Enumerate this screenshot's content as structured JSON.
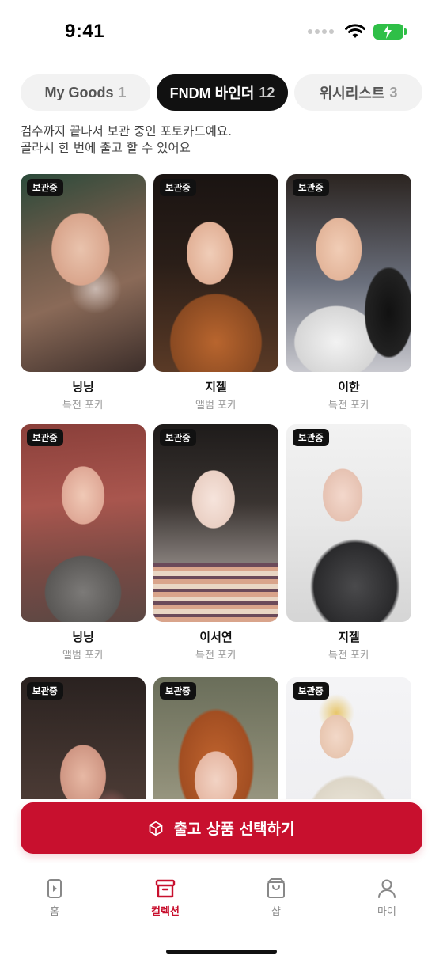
{
  "status_bar": {
    "time": "9:41",
    "icons": [
      "signal-dots-icon",
      "wifi-icon",
      "battery-charging-icon"
    ]
  },
  "tabs": [
    {
      "label": "My Goods",
      "count": "1",
      "active": false
    },
    {
      "label": "FNDM 바인더",
      "count": "12",
      "active": true
    },
    {
      "label": "위시리스트",
      "count": "3",
      "active": false
    }
  ],
  "description": {
    "line1": "검수까지 끝나서 보관 중인 포토카드예요.",
    "line2": "골라서 한 번에 출고 할 수 있어요"
  },
  "cards": [
    {
      "badge": "보관중",
      "name": "닝닝",
      "type": "특전 포카"
    },
    {
      "badge": "보관중",
      "name": "지젤",
      "type": "앨범 포카"
    },
    {
      "badge": "보관중",
      "name": "이한",
      "type": "특전 포카"
    },
    {
      "badge": "보관중",
      "name": "닝닝",
      "type": "앨범 포카"
    },
    {
      "badge": "보관중",
      "name": "이서연",
      "type": "특전 포카"
    },
    {
      "badge": "보관중",
      "name": "지젤",
      "type": "특전 포카"
    },
    {
      "badge": "보관중",
      "name": "",
      "type": ""
    },
    {
      "badge": "보관중",
      "name": "",
      "type": ""
    },
    {
      "badge": "보관중",
      "name": "",
      "type": ""
    }
  ],
  "cta": {
    "label": "출고 상품 선택하기",
    "icon": "box-icon"
  },
  "bottom_nav": [
    {
      "label": "홈",
      "icon": "play-card-icon",
      "active": false
    },
    {
      "label": "컬렉션",
      "icon": "archive-box-icon",
      "active": true
    },
    {
      "label": "샵",
      "icon": "shopping-bag-icon",
      "active": false
    },
    {
      "label": "마이",
      "icon": "person-icon",
      "active": false
    }
  ],
  "colors": {
    "accent": "#c8102e",
    "active_tab_bg": "#111111",
    "inactive_tab_bg": "#f2f2f2",
    "battery": "#2fbf47"
  }
}
